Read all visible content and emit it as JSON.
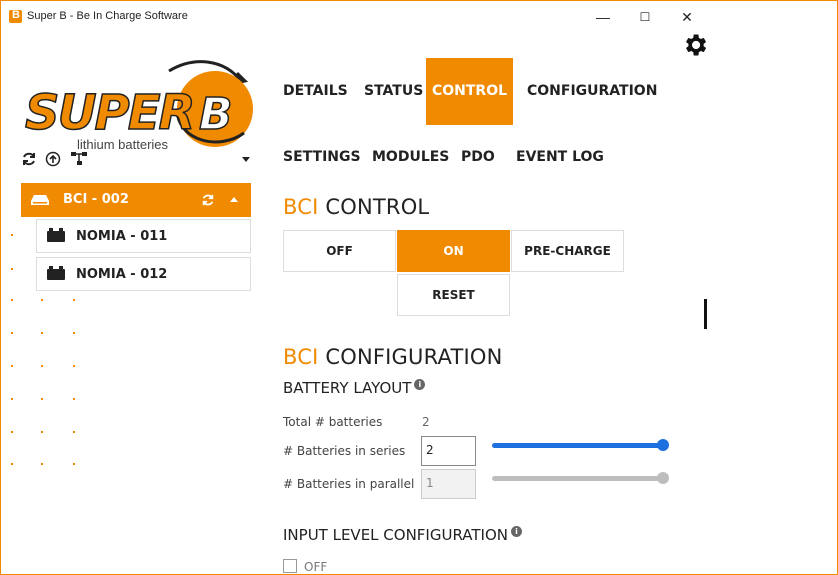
{
  "window": {
    "title": "Super B - Be In Charge Software",
    "minimize": "—",
    "maximize": "☐",
    "close": "✕"
  },
  "logo": {
    "brand": "SUPER B",
    "tagline": "lithium batteries"
  },
  "sidebar": {
    "toolbar_icons": [
      "refresh-icon",
      "upload-icon",
      "network-icon",
      "chevron-down-icon"
    ],
    "tree": {
      "selected": {
        "label": "BCI - 002",
        "icons": [
          "bci-icon",
          "refresh-icon",
          "chevron-up-icon"
        ]
      },
      "children": [
        {
          "label": "NOMIA - 011",
          "icon": "battery-icon"
        },
        {
          "label": "NOMIA - 012",
          "icon": "battery-icon"
        }
      ]
    }
  },
  "tabs": [
    {
      "label": "DETAILS",
      "active": false
    },
    {
      "label": "STATUS",
      "active": false
    },
    {
      "label": "CONTROL",
      "active": true
    },
    {
      "label": "CONFIGURATION",
      "active": false
    }
  ],
  "subtabs": [
    "SETTINGS",
    "MODULES",
    "PDO",
    "EVENT LOG"
  ],
  "control": {
    "heading_accent": "BCI",
    "heading_rest": " CONTROL",
    "buttons": {
      "off": "OFF",
      "on": "ON",
      "precharge": "PRE-CHARGE",
      "reset": "RESET"
    },
    "active_button": "ON"
  },
  "configuration": {
    "heading_accent": "BCI",
    "heading_rest": " CONFIGURATION",
    "battery_layout": {
      "title": "BATTERY LAYOUT",
      "total_label": "Total # batteries",
      "total_value": "2",
      "series_label": "# Batteries in series",
      "series_value": "2",
      "series_slider": 1.0,
      "parallel_label": "# Batteries in parallel",
      "parallel_value": "1",
      "parallel_slider": 1.0
    },
    "input_level": {
      "title": "INPUT LEVEL CONFIGURATION",
      "checkbox_label": "OFF",
      "checked": false
    }
  },
  "colors": {
    "accent": "#f08a00",
    "slider_active": "#1e6fe0",
    "slider_disabled": "#bdbdbd"
  }
}
